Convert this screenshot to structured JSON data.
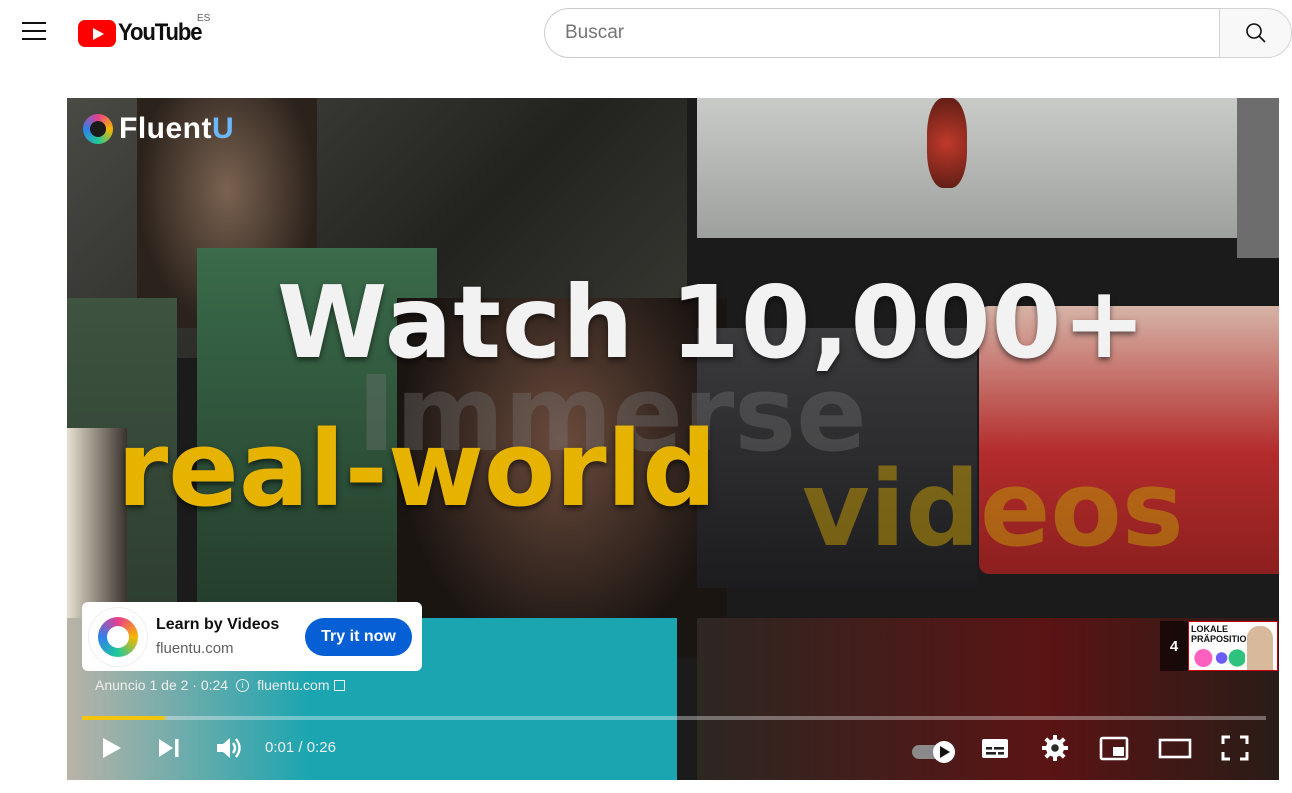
{
  "header": {
    "menu_icon": "hamburger-menu-icon",
    "logo_text": "YouTube",
    "region_code": "ES",
    "search_placeholder": "Buscar",
    "search_icon": "search-icon"
  },
  "video": {
    "brand": {
      "name_part1": "Fluent",
      "name_part2": "U"
    },
    "overlay_text_line1": "Watch 10,000+",
    "overlay_ghost_text": "Immerse",
    "overlay_text_line2": "real-world",
    "overlay_text_line3": "videos"
  },
  "ad": {
    "title": "Learn by Videos",
    "domain": "fluentu.com",
    "cta_label": "Try it now",
    "meta_label": "Anuncio 1 de 2 · 0:24",
    "meta_link": "fluentu.com",
    "info_icon": "info-icon",
    "external_icon": "external-link-icon"
  },
  "next_up": {
    "count": "4",
    "thumb_title": "LOKALE PRÄPOSITIONEN"
  },
  "player": {
    "progress_fraction": 0.07,
    "progress_color": "#f1c40f",
    "time_current": "0:01",
    "time_separator": "/",
    "time_total": "0:26",
    "controls": [
      "play-icon",
      "next-icon",
      "volume-icon",
      "autoplay-toggle-icon",
      "subtitles-icon",
      "settings-icon",
      "miniplayer-icon",
      "theater-mode-icon",
      "fullscreen-icon"
    ]
  },
  "colors": {
    "brand_red": "#ff0000",
    "cta_blue": "#065fd4",
    "fluentu_yellow": "#e6b400"
  }
}
